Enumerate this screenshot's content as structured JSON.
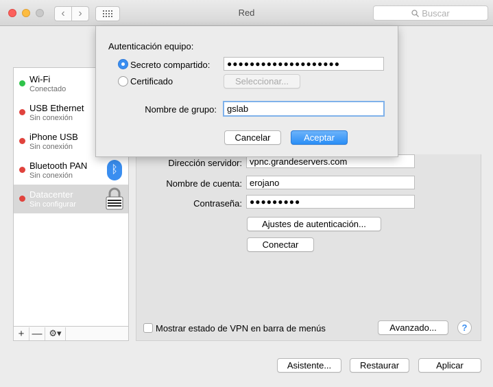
{
  "window": {
    "title": "Red"
  },
  "search": {
    "placeholder": "Buscar"
  },
  "services": [
    {
      "name": "Wi-Fi",
      "status": "Conectado",
      "dot_color": "#2fc34a"
    },
    {
      "name": "USB Ethernet",
      "status": "Sin conexión",
      "dot_color": "#e0433d"
    },
    {
      "name": "iPhone USB",
      "status": "Sin conexión",
      "dot_color": "#e0433d"
    },
    {
      "name": "Bluetooth PAN",
      "status": "Sin conexión",
      "dot_color": "#e0433d"
    },
    {
      "name": "Datacenter",
      "status": "Sin configurar",
      "dot_color": "#e0433d",
      "selected": true
    }
  ],
  "sidebar_tools": {
    "add": "+",
    "remove": "—",
    "gear": "⚙▾"
  },
  "vpn": {
    "server_label": "Dirección servidor:",
    "server_value": "vpnc.grandeservers.com",
    "account_label": "Nombre de cuenta:",
    "account_value": "erojano",
    "password_label": "Contraseña:",
    "password_value": "●●●●●●●●●",
    "auth_settings_button": "Ajustes de autenticación...",
    "connect_button": "Conectar",
    "show_status_label": "Mostrar estado de VPN en barra de menús",
    "advanced_button": "Avanzado...",
    "help": "?"
  },
  "sheet": {
    "heading": "Autenticación equipo:",
    "shared_secret_label": "Secreto compartido:",
    "shared_secret_value": "●●●●●●●●●●●●●●●●●●●●",
    "certificate_label": "Certificado",
    "select_button": "Seleccionar...",
    "group_name_label": "Nombre de grupo:",
    "group_name_value": "gslab",
    "cancel_button": "Cancelar",
    "accept_button": "Aceptar"
  },
  "footer": {
    "assistant_button": "Asistente...",
    "revert_button": "Restaurar",
    "apply_button": "Aplicar"
  }
}
